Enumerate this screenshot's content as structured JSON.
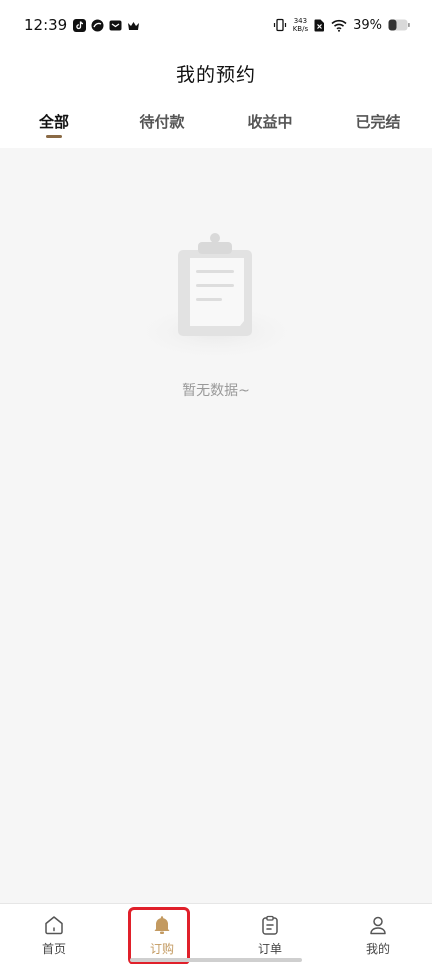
{
  "status_bar": {
    "time": "12:39",
    "net_speed_value": "343",
    "net_speed_unit": "KB/s",
    "battery": "39%"
  },
  "header": {
    "title": "我的预约"
  },
  "tabs": [
    {
      "label": "全部",
      "active": true
    },
    {
      "label": "待付款",
      "active": false
    },
    {
      "label": "收益中",
      "active": false
    },
    {
      "label": "已完结",
      "active": false
    }
  ],
  "empty_state": {
    "text": "暂无数据~"
  },
  "bottom_nav": [
    {
      "label": "首页",
      "icon": "home-icon",
      "active": false
    },
    {
      "label": "订购",
      "icon": "bell-icon",
      "active": true
    },
    {
      "label": "订单",
      "icon": "clipboard-icon",
      "active": false
    },
    {
      "label": "我的",
      "icon": "user-icon",
      "active": false
    }
  ],
  "colors": {
    "accent": "#c39a61",
    "tab_indicator": "#8a6a45",
    "highlight": "#e0202a",
    "background": "#f6f6f6"
  }
}
